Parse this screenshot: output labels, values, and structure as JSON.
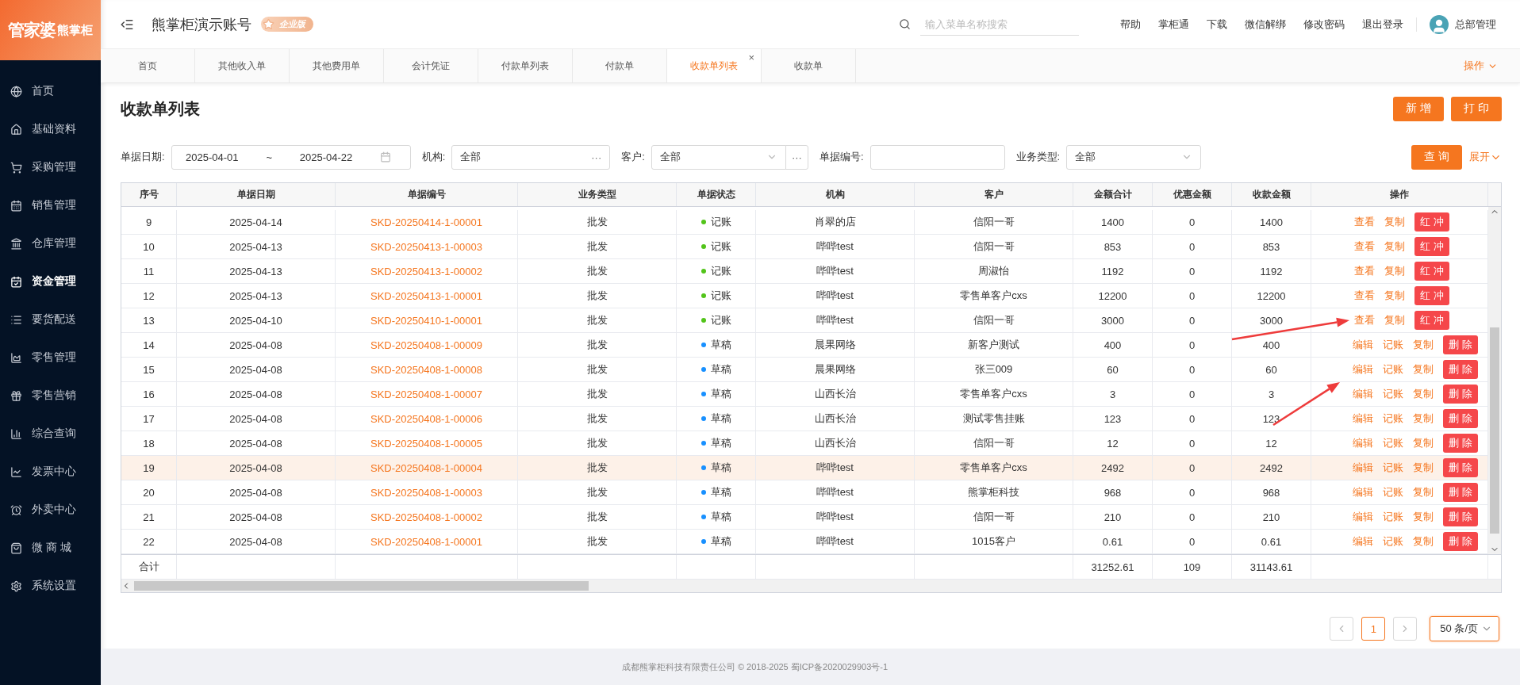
{
  "logo": {
    "brand": "管家婆",
    "sub": "熊掌柜"
  },
  "sidebar": {
    "items": [
      {
        "label": "首页",
        "selected": false
      },
      {
        "label": "基础资料",
        "selected": false
      },
      {
        "label": "采购管理",
        "selected": false
      },
      {
        "label": "销售管理",
        "selected": false
      },
      {
        "label": "仓库管理",
        "selected": false
      },
      {
        "label": "资金管理",
        "selected": true
      },
      {
        "label": "要货配送",
        "selected": false
      },
      {
        "label": "零售管理",
        "selected": false
      },
      {
        "label": "零售营销",
        "selected": false
      },
      {
        "label": "综合查询",
        "selected": false
      },
      {
        "label": "发票中心",
        "selected": false
      },
      {
        "label": "外卖中心",
        "selected": false
      },
      {
        "label": "微 商 城",
        "selected": false
      },
      {
        "label": "系统设置",
        "selected": false
      }
    ]
  },
  "header": {
    "account": "熊掌柜演示账号",
    "edition": "企业版",
    "search": {
      "placeholder": "输入菜单名称搜索"
    },
    "links": [
      "帮助",
      "掌柜通",
      "下载",
      "微信解绑",
      "修改密码",
      "退出登录"
    ],
    "user": "总部管理"
  },
  "tabs": [
    {
      "label": "首页",
      "selected": false
    },
    {
      "label": "其他收入单",
      "selected": false
    },
    {
      "label": "其他费用单",
      "selected": false
    },
    {
      "label": "会计凭证",
      "selected": false
    },
    {
      "label": "付款单列表",
      "selected": false
    },
    {
      "label": "付款单",
      "selected": false
    },
    {
      "label": "收款单列表",
      "selected": true,
      "close": "×"
    },
    {
      "label": "收款单",
      "selected": false
    }
  ],
  "tab_menu": "操作",
  "page": {
    "title": "收款单列表",
    "buttons": [
      "新 增",
      "打 印"
    ]
  },
  "filters": {
    "date": {
      "label": "单据日期:",
      "from": "2025-04-01",
      "sep": "~",
      "to": "2025-04-22"
    },
    "org": {
      "label": "机构:",
      "value": "全部",
      "more": "···"
    },
    "customer": {
      "label": "客户:",
      "value": "全部",
      "more": "···"
    },
    "number": {
      "label": "单据编号:"
    },
    "type": {
      "label": "业务类型:",
      "value": "全部"
    },
    "search_button": "查 询",
    "expand": "展开"
  },
  "table": {
    "columns": [
      "序号",
      "单据日期",
      "单据编号",
      "业务类型",
      "单据状态",
      "机构",
      "客户",
      "金额合计",
      "优惠金额",
      "收款金额",
      "操作"
    ],
    "rows": [
      {
        "no": "9",
        "date": "2025-04-14",
        "code": "SKD-20250414-1-00001",
        "type": "批发",
        "status": {
          "label": "记账",
          "color": "#52c41a"
        },
        "org": "肖翠的店",
        "customer": "信阳一哥",
        "total": "1400",
        "discount": "0",
        "received": "1400",
        "selected": false,
        "actions": [
          {
            "label": "查看",
            "kind": "link"
          },
          {
            "label": "复制",
            "kind": "link"
          },
          {
            "label": "红 冲",
            "kind": "danger"
          }
        ]
      },
      {
        "no": "10",
        "date": "2025-04-13",
        "code": "SKD-20250413-1-00003",
        "type": "批发",
        "status": {
          "label": "记账",
          "color": "#52c41a"
        },
        "org": "哔哔test",
        "customer": "信阳一哥",
        "total": "853",
        "discount": "0",
        "received": "853",
        "selected": false,
        "actions": [
          {
            "label": "查看",
            "kind": "link"
          },
          {
            "label": "复制",
            "kind": "link"
          },
          {
            "label": "红 冲",
            "kind": "danger"
          }
        ]
      },
      {
        "no": "11",
        "date": "2025-04-13",
        "code": "SKD-20250413-1-00002",
        "type": "批发",
        "status": {
          "label": "记账",
          "color": "#52c41a"
        },
        "org": "哔哔test",
        "customer": "周淑怡",
        "total": "1192",
        "discount": "0",
        "received": "1192",
        "selected": false,
        "actions": [
          {
            "label": "查看",
            "kind": "link"
          },
          {
            "label": "复制",
            "kind": "link"
          },
          {
            "label": "红 冲",
            "kind": "danger"
          }
        ]
      },
      {
        "no": "12",
        "date": "2025-04-13",
        "code": "SKD-20250413-1-00001",
        "type": "批发",
        "status": {
          "label": "记账",
          "color": "#52c41a"
        },
        "org": "哔哔test",
        "customer": "零售单客户cxs",
        "total": "12200",
        "discount": "0",
        "received": "12200",
        "selected": false,
        "actions": [
          {
            "label": "查看",
            "kind": "link"
          },
          {
            "label": "复制",
            "kind": "link"
          },
          {
            "label": "红 冲",
            "kind": "danger"
          }
        ]
      },
      {
        "no": "13",
        "date": "2025-04-10",
        "code": "SKD-20250410-1-00001",
        "type": "批发",
        "status": {
          "label": "记账",
          "color": "#52c41a"
        },
        "org": "哔哔test",
        "customer": "信阳一哥",
        "total": "3000",
        "discount": "0",
        "received": "3000",
        "selected": false,
        "actions": [
          {
            "label": "查看",
            "kind": "link"
          },
          {
            "label": "复制",
            "kind": "link"
          },
          {
            "label": "红 冲",
            "kind": "danger"
          }
        ]
      },
      {
        "no": "14",
        "date": "2025-04-08",
        "code": "SKD-20250408-1-00009",
        "type": "批发",
        "status": {
          "label": "草稿",
          "color": "#1890ff"
        },
        "org": "晨果网络",
        "customer": "新客户测试",
        "total": "400",
        "discount": "0",
        "received": "400",
        "selected": false,
        "actions": [
          {
            "label": "编辑",
            "kind": "link"
          },
          {
            "label": "记账",
            "kind": "link"
          },
          {
            "label": "复制",
            "kind": "link"
          },
          {
            "label": "删 除",
            "kind": "danger"
          }
        ]
      },
      {
        "no": "15",
        "date": "2025-04-08",
        "code": "SKD-20250408-1-00008",
        "type": "批发",
        "status": {
          "label": "草稿",
          "color": "#1890ff"
        },
        "org": "晨果网络",
        "customer": "张三009",
        "total": "60",
        "discount": "0",
        "received": "60",
        "selected": false,
        "actions": [
          {
            "label": "编辑",
            "kind": "link"
          },
          {
            "label": "记账",
            "kind": "link"
          },
          {
            "label": "复制",
            "kind": "link"
          },
          {
            "label": "删 除",
            "kind": "danger"
          }
        ]
      },
      {
        "no": "16",
        "date": "2025-04-08",
        "code": "SKD-20250408-1-00007",
        "type": "批发",
        "status": {
          "label": "草稿",
          "color": "#1890ff"
        },
        "org": "山西长治",
        "customer": "零售单客户cxs",
        "total": "3",
        "discount": "0",
        "received": "3",
        "selected": false,
        "actions": [
          {
            "label": "编辑",
            "kind": "link"
          },
          {
            "label": "记账",
            "kind": "link"
          },
          {
            "label": "复制",
            "kind": "link"
          },
          {
            "label": "删 除",
            "kind": "danger"
          }
        ]
      },
      {
        "no": "17",
        "date": "2025-04-08",
        "code": "SKD-20250408-1-00006",
        "type": "批发",
        "status": {
          "label": "草稿",
          "color": "#1890ff"
        },
        "org": "山西长治",
        "customer": "测试零售挂账",
        "total": "123",
        "discount": "0",
        "received": "123",
        "selected": false,
        "actions": [
          {
            "label": "编辑",
            "kind": "link"
          },
          {
            "label": "记账",
            "kind": "link"
          },
          {
            "label": "复制",
            "kind": "link"
          },
          {
            "label": "删 除",
            "kind": "danger"
          }
        ]
      },
      {
        "no": "18",
        "date": "2025-04-08",
        "code": "SKD-20250408-1-00005",
        "type": "批发",
        "status": {
          "label": "草稿",
          "color": "#1890ff"
        },
        "org": "山西长治",
        "customer": "信阳一哥",
        "total": "12",
        "discount": "0",
        "received": "12",
        "selected": false,
        "actions": [
          {
            "label": "编辑",
            "kind": "link"
          },
          {
            "label": "记账",
            "kind": "link"
          },
          {
            "label": "复制",
            "kind": "link"
          },
          {
            "label": "删 除",
            "kind": "danger"
          }
        ]
      },
      {
        "no": "19",
        "date": "2025-04-08",
        "code": "SKD-20250408-1-00004",
        "type": "批发",
        "status": {
          "label": "草稿",
          "color": "#1890ff"
        },
        "org": "哔哔test",
        "customer": "零售单客户cxs",
        "total": "2492",
        "discount": "0",
        "received": "2492",
        "selected": true,
        "actions": [
          {
            "label": "编辑",
            "kind": "link"
          },
          {
            "label": "记账",
            "kind": "link"
          },
          {
            "label": "复制",
            "kind": "link"
          },
          {
            "label": "删 除",
            "kind": "danger"
          }
        ]
      },
      {
        "no": "20",
        "date": "2025-04-08",
        "code": "SKD-20250408-1-00003",
        "type": "批发",
        "status": {
          "label": "草稿",
          "color": "#1890ff"
        },
        "org": "哔哔test",
        "customer": "熊掌柜科技",
        "total": "968",
        "discount": "0",
        "received": "968",
        "selected": false,
        "actions": [
          {
            "label": "编辑",
            "kind": "link"
          },
          {
            "label": "记账",
            "kind": "link"
          },
          {
            "label": "复制",
            "kind": "link"
          },
          {
            "label": "删 除",
            "kind": "danger"
          }
        ]
      },
      {
        "no": "21",
        "date": "2025-04-08",
        "code": "SKD-20250408-1-00002",
        "type": "批发",
        "status": {
          "label": "草稿",
          "color": "#1890ff"
        },
        "org": "哔哔test",
        "customer": "信阳一哥",
        "total": "210",
        "discount": "0",
        "received": "210",
        "selected": false,
        "actions": [
          {
            "label": "编辑",
            "kind": "link"
          },
          {
            "label": "记账",
            "kind": "link"
          },
          {
            "label": "复制",
            "kind": "link"
          },
          {
            "label": "删 除",
            "kind": "danger"
          }
        ]
      },
      {
        "no": "22",
        "date": "2025-04-08",
        "code": "SKD-20250408-1-00001",
        "type": "批发",
        "status": {
          "label": "草稿",
          "color": "#1890ff"
        },
        "org": "哔哔test",
        "customer": "1015客户",
        "total": "0.61",
        "discount": "0",
        "received": "0.61",
        "selected": false,
        "actions": [
          {
            "label": "编辑",
            "kind": "link"
          },
          {
            "label": "记账",
            "kind": "link"
          },
          {
            "label": "复制",
            "kind": "link"
          },
          {
            "label": "删 除",
            "kind": "danger"
          }
        ]
      }
    ],
    "summary": {
      "label": "合计",
      "total": "31252.61",
      "discount": "109",
      "received": "31143.61"
    }
  },
  "pagination": {
    "pages": [
      {
        "label": "1",
        "selected": true
      }
    ],
    "page_size": "50 条/页"
  },
  "footer": "成都熊掌柜科技有限责任公司 © 2018-2025 蜀ICP备2020029903号-1"
}
